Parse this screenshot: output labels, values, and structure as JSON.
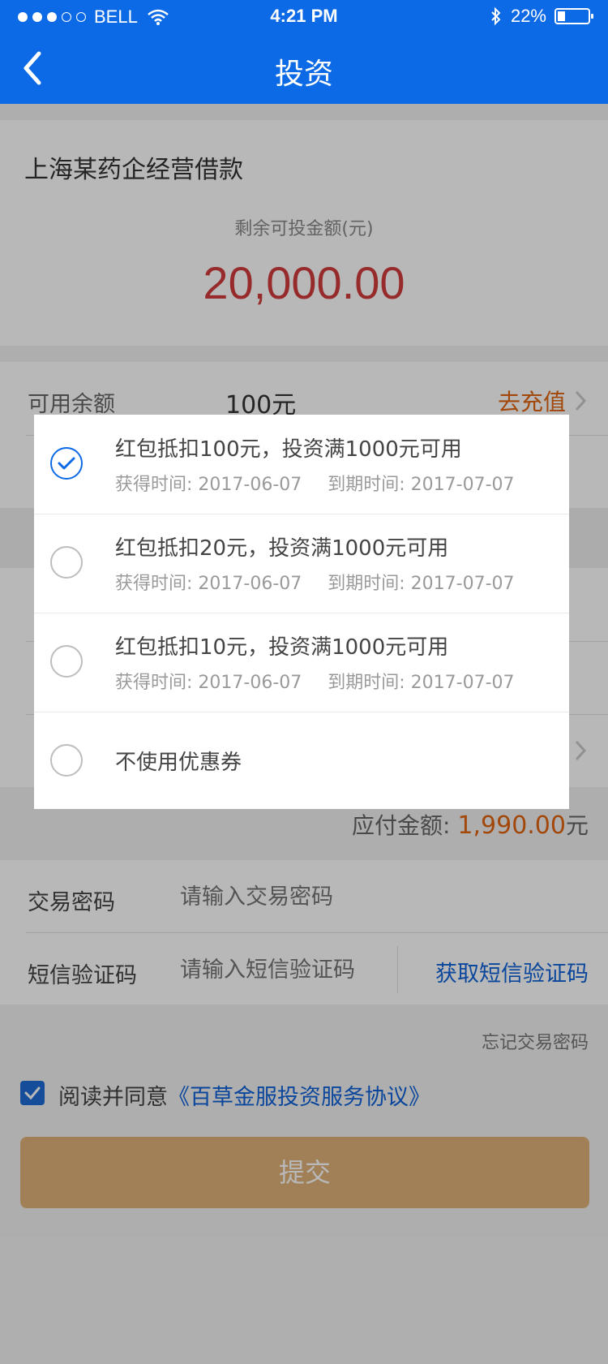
{
  "status_bar": {
    "carrier": "BELL",
    "time": "4:21 PM",
    "battery": "22%"
  },
  "nav": {
    "title": "投资"
  },
  "loan": {
    "name": "上海某药企经营借款",
    "remaining_label": "剩余可投金额(元)",
    "remaining_amount": "20,000.00"
  },
  "balance": {
    "label": "可用余额",
    "value": "100元",
    "recharge_label": "去充值"
  },
  "payable": {
    "label": "应付金额:",
    "amount": "1,990.00",
    "unit": "元"
  },
  "form": {
    "password_label": "交易密码",
    "password_placeholder": "请输入交易密码",
    "sms_label": "短信验证码",
    "sms_placeholder": "请输入短信验证码",
    "sms_button": "获取短信验证码",
    "forgot": "忘记交易密码"
  },
  "agreement": {
    "prefix": "阅读并同意",
    "link": "《百草金服投资服务协议》",
    "checked": true
  },
  "submit_label": "提交",
  "coupon_modal": {
    "options": [
      {
        "title": "红包抵扣100元，投资满1000元可用",
        "obtained": "获得时间: 2017-06-07",
        "expires": "到期时间: 2017-07-07",
        "selected": true
      },
      {
        "title": "红包抵扣20元，投资满1000元可用",
        "obtained": "获得时间: 2017-06-07",
        "expires": "到期时间: 2017-07-07",
        "selected": false
      },
      {
        "title": "红包抵扣10元，投资满1000元可用",
        "obtained": "获得时间: 2017-06-07",
        "expires": "到期时间: 2017-07-07",
        "selected": false
      },
      {
        "title": "不使用优惠券",
        "selected": false
      }
    ]
  },
  "colors": {
    "brand_blue": "#0d6ae6",
    "amount_red": "#d23b3b",
    "accent_orange": "#e0640f",
    "submit_bg": "#e0b27a"
  }
}
